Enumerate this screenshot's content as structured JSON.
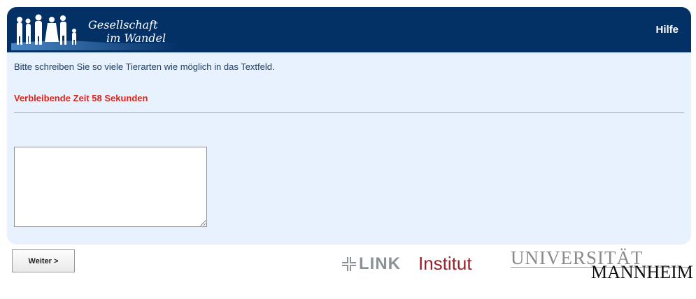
{
  "header": {
    "logo_line1": "Gesellschaft",
    "logo_line2": "im Wandel",
    "help_label": "Hilfe",
    "bg_color": "#033166"
  },
  "survey": {
    "instruction": "Bitte schreiben Sie so viele Tierarten wie möglich in das Textfeld.",
    "timer": "Verbleibende Zeit 58 Sekunden",
    "answer_value": "",
    "panel_color": "#e8f1fe",
    "timer_color": "#e0241a"
  },
  "footer": {
    "next_label": "Weiter >",
    "link_logo_text": "LINK",
    "link_logo_suffix": "Institut",
    "uni_top": "UNIVERSITÄT",
    "uni_bottom": "MANNHEIM"
  }
}
